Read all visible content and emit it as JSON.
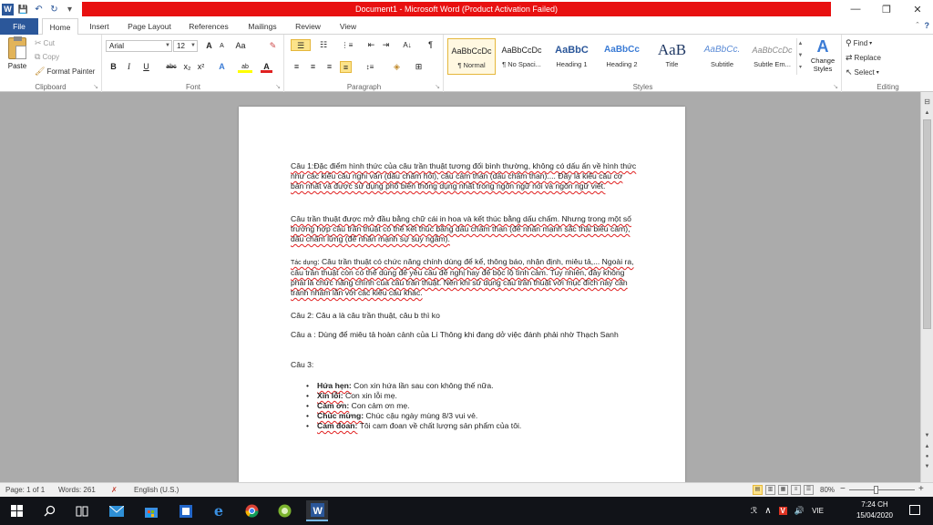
{
  "window": {
    "title": "Document1 - Microsoft Word (Product Activation Failed)",
    "minimize_glyph": "—",
    "restore_glyph": "❐",
    "close_glyph": "✕"
  },
  "qat": {
    "word_icon": "W",
    "save_glyph": "💾",
    "undo_glyph": "↶",
    "redo_glyph": "↻",
    "customize_glyph": "▾"
  },
  "tabs": [
    "File",
    "Home",
    "Insert",
    "Page Layout",
    "References",
    "Mailings",
    "Review",
    "View"
  ],
  "help": {
    "collapse_glyph": "ˆ",
    "help_glyph": "?"
  },
  "clipboard": {
    "paste": "Paste",
    "cut": "Cut",
    "copy": "Copy",
    "format_painter": "Format Painter",
    "group_label": "Clipboard"
  },
  "font": {
    "name": "Arial",
    "size": "12",
    "grow": "A",
    "shrink": "A",
    "change_case": "Aa",
    "clear_glyph": "✎",
    "bold": "B",
    "italic": "I",
    "underline": "U",
    "strike": "abc",
    "sub": "x₂",
    "sup": "x²",
    "effects": "A",
    "highlight": "ab",
    "color": "A",
    "group_label": "Font"
  },
  "paragraph": {
    "bullets": "☰",
    "numbering": "☷",
    "multilevel": "⋮≡",
    "dec_indent": "⇤",
    "inc_indent": "⇥",
    "sort": "A↓",
    "pilcrow": "¶",
    "align_left": "≡",
    "align_center": "≡",
    "align_right": "≡",
    "justify": "≡",
    "line_spacing": "↕≡",
    "shading": "◈",
    "borders": "⊞",
    "group_label": "Paragraph"
  },
  "styles": {
    "items": [
      {
        "preview": "AaBbCcDc",
        "name": "¶ Normal"
      },
      {
        "preview": "AaBbCcDc",
        "name": "¶ No Spaci..."
      },
      {
        "preview": "AaBbC",
        "name": "Heading 1"
      },
      {
        "preview": "AaBbCc",
        "name": "Heading 2"
      },
      {
        "preview": "AaB",
        "name": "Title"
      },
      {
        "preview": "AaBbCc.",
        "name": "Subtitle"
      },
      {
        "preview": "AaBbCcDc",
        "name": "Subtle Em..."
      }
    ],
    "change_styles": "Change Styles",
    "change_icon": "A",
    "group_label": "Styles"
  },
  "editing": {
    "find": "Find",
    "replace": "Replace",
    "select": "Select",
    "group_label": "Editing"
  },
  "document": {
    "p1": "Câu 1:Đặc điểm hình thức của câu trần thuật tương đối bình thường, không có dấu ấn về hình thức như các kiểu câu nghi vấn (dấu chấm hỏi), câu cảm thán (dấu chấm than).... Đây là kiểu câu cơ bản nhất và được sử dụng phổ biến thông dụng nhất trong ngôn ngữ nói và ngôn ngữ viết.",
    "p2": "Câu trần thuật được mở đầu bằng chữ cái in hoa và kết thúc bằng dấu chấm. Nhưng trong một số trường hợp câu trần thuật có thể kết thúc bằng dấu chấm than (để nhấn mạnh sắc thái biểu cảm), dấu chấm lửng (để nhấn mạnh sự suy ngẫm).",
    "p3_label": "Tác dụng",
    "p3": ": Câu trần thuật có chức năng chính dùng để kể, thông báo, nhận định, miêu tả,... Ngoài ra, câu trần thuật còn có thể dùng để yêu cầu đề nghị hay để bộc lộ tình cảm. Tuy nhiên, đây không phải là chức năng chính của câu trần thuật. Nên khi sử dụng câu trần thuật với mục đích này cần tránh nhầm lẫn với các kiểu câu khác.",
    "p4": "Câu 2: Câu  a là câu trần thuật, câu b thì ko",
    "p5": "Câu a : Dùng để miêu tả hoàn cảnh của Lí Thông khi đang dở việc đánh phải nhờ Thạch Sanh",
    "p6": "Câu 3:",
    "bullets": [
      {
        "term": "Hứa hẹn:",
        "text": " Con xin hứa lần sau con không thế nữa."
      },
      {
        "term": "Xin lỗi:",
        "text": " Con xin lỗi mẹ."
      },
      {
        "term": "Cảm ơn:",
        "text": " Con cảm ơn mẹ."
      },
      {
        "term": "Chúc mừng:",
        "text": " Chúc cậu ngày mùng 8/3 vui vẻ."
      },
      {
        "term": "Cam đoan:",
        "text": " Tôi cam đoan về chất lượng sản phẩm của tôi."
      }
    ]
  },
  "statusbar": {
    "page": "Page: 1 of 1",
    "words": "Words: 261",
    "language": "English (U.S.)",
    "zoom": "80%",
    "zoom_out": "−",
    "zoom_in": "+"
  },
  "taskbar": {
    "ime": "VIE",
    "time": "7:24 CH",
    "date": "15/04/2020",
    "v_badge": "V"
  },
  "colors": {
    "word_blue": "#2b579a",
    "title_red": "#e81010",
    "highlight": "#fce38a"
  }
}
